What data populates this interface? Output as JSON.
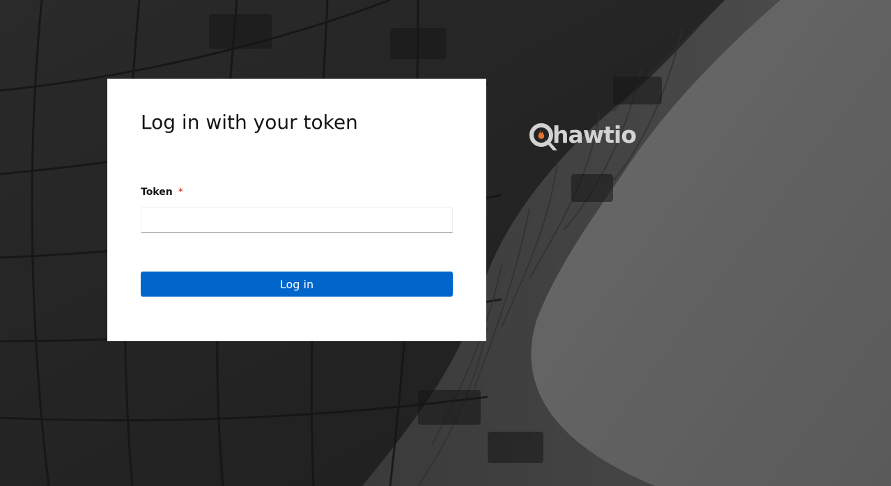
{
  "login": {
    "title": "Log in with your token",
    "token_label": "Token",
    "required_marker": "*",
    "token_value": "",
    "token_placeholder": "",
    "submit_label": "Log in"
  },
  "brand": {
    "name": "hawtio",
    "logo_icon": "hawtio-flame-logo-icon"
  },
  "colors": {
    "primary_button": "#0066cc",
    "required": "#c9190b",
    "logo_flame": "#e8742b",
    "logo_text": "#d2d2d2",
    "background_dark": "#232323",
    "background_light": "#5f5f5f"
  }
}
